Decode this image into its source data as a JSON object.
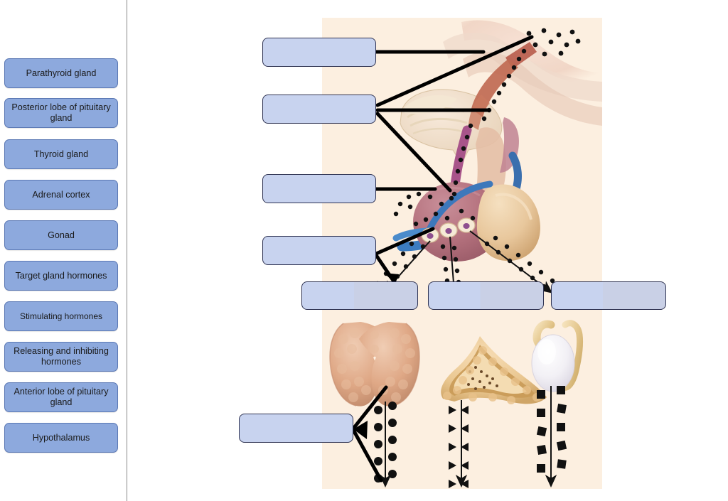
{
  "page": {
    "title": "Endocrine system labeling exercise",
    "background_color": "#ffffff",
    "figure_background_color": "#fcefe0",
    "chip_color": "#8da9dd",
    "chip_border_color": "#5b78b4",
    "drop_color": "#c8d3ef",
    "drop_border_color": "#2f3352"
  },
  "sidebar": {
    "name": "draggable-label-bank",
    "items": [
      {
        "id": "parathyroid-gland",
        "label": "Parathyroid gland"
      },
      {
        "id": "posterior-lobe-pituitary",
        "label": "Posterior lobe of pituitary gland"
      },
      {
        "id": "thyroid-gland",
        "label": "Thyroid gland"
      },
      {
        "id": "adrenal-cortex",
        "label": "Adrenal cortex"
      },
      {
        "id": "gonad",
        "label": "Gonad"
      },
      {
        "id": "target-gland-hormones",
        "label": "Target gland hormones"
      },
      {
        "id": "stimulating-hormones",
        "label": "Stimulating hormones"
      },
      {
        "id": "releasing-inhibiting-hormones",
        "label": "Releasing and inhibiting hormones"
      },
      {
        "id": "anterior-lobe-pituitary",
        "label": "Anterior lobe of pituitary gland"
      },
      {
        "id": "hypothalamus",
        "label": "Hypothalamus"
      }
    ]
  },
  "diagram": {
    "name": "endocrine-axis-diagram",
    "drop_targets": [
      {
        "id": "drop-1",
        "value": "",
        "placeholder": ""
      },
      {
        "id": "drop-2",
        "value": "",
        "placeholder": ""
      },
      {
        "id": "drop-3",
        "value": "",
        "placeholder": ""
      },
      {
        "id": "drop-4",
        "value": "",
        "placeholder": ""
      },
      {
        "id": "drop-5",
        "value": "",
        "placeholder": ""
      },
      {
        "id": "drop-6",
        "value": "",
        "placeholder": ""
      },
      {
        "id": "drop-7",
        "value": "",
        "placeholder": ""
      },
      {
        "id": "drop-8",
        "value": "",
        "placeholder": ""
      }
    ],
    "illustration_parts": [
      {
        "id": "hypothalamus-tissue",
        "label": "hypothalamus"
      },
      {
        "id": "optic-chiasm",
        "label": "optic chiasm"
      },
      {
        "id": "pituitary-stalk",
        "label": "infundibulum"
      },
      {
        "id": "anterior-pituitary",
        "label": "anterior lobe of pituitary gland"
      },
      {
        "id": "posterior-pituitary",
        "label": "posterior lobe of pituitary gland"
      },
      {
        "id": "thyroid-organ",
        "label": "thyroid gland"
      },
      {
        "id": "adrenal-cortex-organ",
        "label": "adrenal cortex"
      },
      {
        "id": "gonad-organ",
        "label": "gonad (testis)"
      }
    ],
    "hormone_flow_markers": [
      {
        "organ": "thyroid-organ",
        "marker": "circle"
      },
      {
        "organ": "adrenal-cortex-organ",
        "marker": "triangle"
      },
      {
        "organ": "gonad-organ",
        "marker": "square"
      }
    ]
  }
}
